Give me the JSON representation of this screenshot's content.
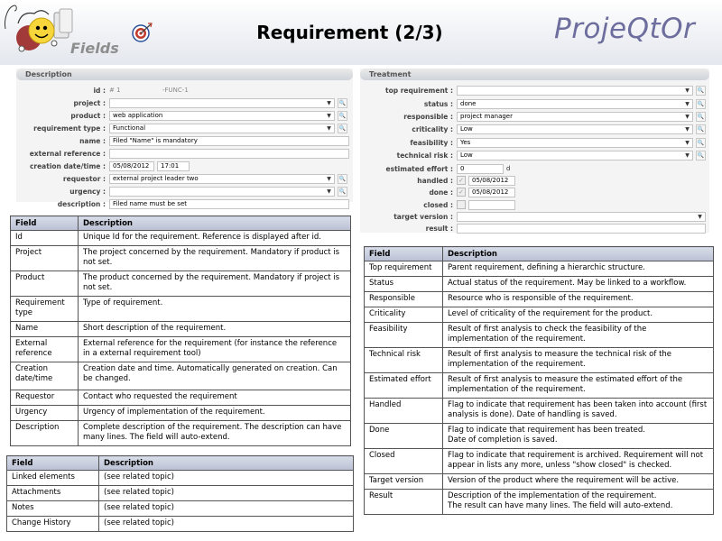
{
  "header": {
    "logo_text": "Fields",
    "title": "Requirement (2/3)",
    "brand": "ProjeQtOr"
  },
  "description_section": {
    "title": "Description",
    "fields": [
      {
        "label": "id :",
        "value": "# 1",
        "extra": "-FUNC-1"
      },
      {
        "label": "project :",
        "value": ""
      },
      {
        "label": "product :",
        "value": "web application"
      },
      {
        "label": "requirement type :",
        "value": "Functional"
      },
      {
        "label": "name :",
        "value": "Filed \"Name\" is mandatory"
      },
      {
        "label": "external reference :",
        "value": ""
      },
      {
        "label": "creation date/time :",
        "value": "05/08/2012",
        "value2": "17:01"
      },
      {
        "label": "requestor :",
        "value": "external project leader two"
      },
      {
        "label": "urgency :",
        "value": ""
      },
      {
        "label": "description :",
        "value": "Filed name must be set"
      }
    ]
  },
  "treatment_section": {
    "title": "Treatment",
    "fields": [
      {
        "label": "top requirement :",
        "value": ""
      },
      {
        "label": "status :",
        "value": "done"
      },
      {
        "label": "responsible :",
        "value": "project manager"
      },
      {
        "label": "criticality :",
        "value": "Low"
      },
      {
        "label": "feasibility :",
        "value": "Yes"
      },
      {
        "label": "technical risk :",
        "value": "Low"
      },
      {
        "label": "estimated effort :",
        "value": "0",
        "unit": "d"
      },
      {
        "label": "handled :",
        "value": "05/08/2012"
      },
      {
        "label": "done :",
        "value": "05/08/2012"
      },
      {
        "label": "closed :",
        "value": ""
      },
      {
        "label": "target version :",
        "value": ""
      },
      {
        "label": "result :",
        "value": ""
      }
    ]
  },
  "table_left": {
    "headers": [
      "Field",
      "Description"
    ],
    "rows": [
      [
        "Id",
        "Unique Id for the requirement. Reference is displayed after id."
      ],
      [
        "Project",
        "The project concerned by the requirement. Mandatory if product is not set."
      ],
      [
        "Product",
        "The product concerned by the requirement. Mandatory if project is not set."
      ],
      [
        "Requirement type",
        "Type of requirement."
      ],
      [
        "Name",
        "Short description of the requirement."
      ],
      [
        "External reference",
        "External reference for the requirement (for instance the reference in a external requirement tool)"
      ],
      [
        "Creation date/time",
        "Creation date and time. Automatically generated on creation. Can be changed."
      ],
      [
        "Requestor",
        "Contact who requested the requirement"
      ],
      [
        "Urgency",
        "Urgency of implementation of the requirement."
      ],
      [
        "Description",
        "Complete description of the requirement. The description can have many lines. The field will auto-extend."
      ]
    ]
  },
  "table_links": {
    "headers": [
      "Field",
      "Description"
    ],
    "rows": [
      [
        "Linked elements",
        "(see related topic)"
      ],
      [
        "Attachments",
        "(see related topic)"
      ],
      [
        "Notes",
        "(see related topic)"
      ],
      [
        "Change History",
        "(see related topic)"
      ]
    ]
  },
  "table_right": {
    "headers": [
      "Field",
      "Description"
    ],
    "rows": [
      [
        "Top requirement",
        "Parent requirement, defining a hierarchic structure."
      ],
      [
        "Status",
        "Actual status of the requirement. May be linked to a workflow."
      ],
      [
        "Responsible",
        "Resource who is responsible of the requirement."
      ],
      [
        "Criticality",
        "Level of criticality of the requirement for the product."
      ],
      [
        "Feasibility",
        "Result of first analysis to check the feasibility of the implementation of the requirement."
      ],
      [
        "Technical risk",
        "Result of first analysis to measure the technical risk of the implementation of the requirement."
      ],
      [
        "Estimated effort",
        "Result of first analysis to measure the estimated effort of the implementation of the requirement."
      ],
      [
        "Handled",
        "Flag to indicate that requirement has been taken into account (first analysis is done). Date of handling is saved."
      ],
      [
        "Done",
        "Flag to indicate that requirement has been treated.\nDate of completion is saved."
      ],
      [
        "Closed",
        "Flag to indicate that requirement is archived. Requirement will not appear in lists any more, unless \"show closed\" is checked."
      ],
      [
        "Target version",
        "Version of the product where the requirement will be active."
      ],
      [
        "Result",
        "Description of the implementation of the requirement.\nThe result can have many lines. The field will auto-extend."
      ]
    ]
  },
  "colors": {
    "brand": "#6e6e9e",
    "table_header": "#b9c0d4",
    "section_header": "#cfd3da"
  }
}
